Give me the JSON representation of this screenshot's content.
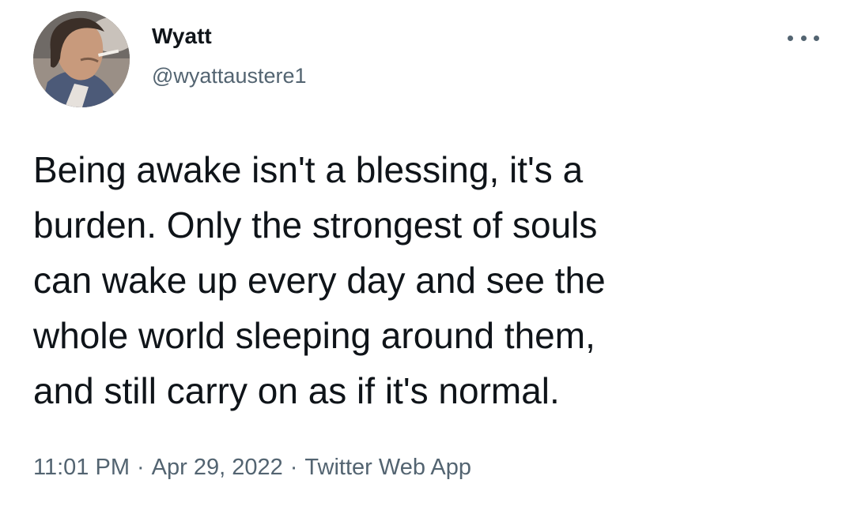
{
  "user": {
    "display_name": "Wyatt",
    "handle": "@wyattaustere1",
    "avatar_icon": "profile-photo"
  },
  "menu": {
    "more_icon": "more-horizontal-icon"
  },
  "tweet": {
    "text_lines": [
      "Being awake isn't a blessing, it's a",
      "burden. Only the strongest of souls",
      "can wake up every day and see the",
      "whole world sleeping around them,",
      "and still carry on as if it's normal."
    ],
    "time": "11:01 PM",
    "date": "Apr 29, 2022",
    "separator": "·",
    "source": "Twitter Web App"
  },
  "colors": {
    "primary_text": "#0f1419",
    "secondary_text": "#536471",
    "background": "#ffffff"
  }
}
